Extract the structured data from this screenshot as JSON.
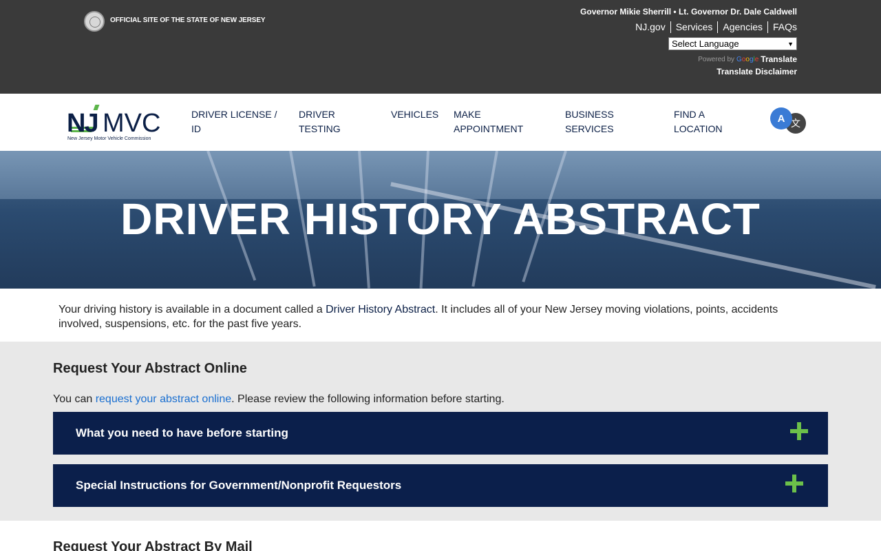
{
  "state_bar": {
    "official": "OFFICIAL SITE OF THE STATE OF NEW JERSEY",
    "governor_line": "Governor Mikie Sherrill • Lt. Governor Dr. Dale Caldwell",
    "links": [
      "NJ.gov",
      "Services",
      "Agencies",
      "FAQs"
    ],
    "language_select": "Select Language",
    "powered_by": "Powered by",
    "google": "Google",
    "translate": "Translate",
    "disclaimer": "Translate Disclaimer"
  },
  "nav": {
    "logo_nj": "NJ",
    "logo_mvc": "MVC",
    "logo_sub": "New Jersey Motor Vehicle Commission",
    "items": [
      {
        "line1": "Driver License /",
        "line2": "ID"
      },
      {
        "line1": "Driver",
        "line2": "Testing"
      },
      {
        "line1": "Vehicles",
        "line2": ""
      },
      {
        "line1": "Make",
        "line2": "Appointment"
      },
      {
        "line1": "Business",
        "line2": "Services"
      },
      {
        "line1": "Find A",
        "line2": "Location"
      }
    ],
    "lang_a": "A",
    "lang_zh": "文"
  },
  "hero": {
    "title": "DRIVER HISTORY ABSTRACT"
  },
  "intro": {
    "before": "Your driving history is available in a document called a ",
    "link": "Driver History Abstract",
    "after": ". It includes all of your New Jersey moving violations, points, accidents involved, suspensions, etc. for the past five years."
  },
  "online": {
    "title": "Request Your Abstract Online",
    "text_before": "You can ",
    "link": "request your abstract online",
    "text_after": ". Please review the following information before starting.",
    "accordions": [
      "What you need to have before starting",
      "Special Instructions for Government/Nonprofit Requestors"
    ]
  },
  "mail": {
    "title": "Request Your Abstract By Mail"
  },
  "colors": {
    "navy": "#0b1f4b",
    "green": "#6cc04a",
    "link_blue": "#1a6fd0",
    "top_bar": "#3a3a3a"
  }
}
